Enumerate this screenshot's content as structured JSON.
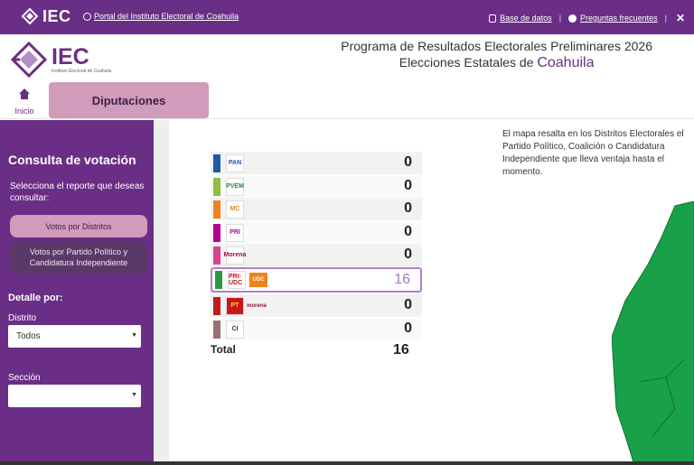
{
  "topbar": {
    "logo_text": "IEC",
    "portal_link": "Portal del Instituto Electoral de Coahuila",
    "links": [
      "Base de datos",
      "Preguntas frecuentes"
    ],
    "icons": [
      "database-icon",
      "question-icon",
      "close-icon"
    ]
  },
  "header": {
    "logo_text": "IEC",
    "logo_subtext": "Instituto Electoral de Coahuila",
    "title_line1": "Programa de Resultados Electorales Preliminares 2026",
    "title_line2": "Elecciones Estatales de",
    "title_state": "Coahuila"
  },
  "nav": {
    "home_label": "Inicio",
    "active_tab": "Diputaciones"
  },
  "sidebar": {
    "heading": "Consulta de votación",
    "hint": "Selecciona el reporte que deseas consultar:",
    "btn_districts": "Votos por Distritos",
    "btn_party": "Votos por Partido Político y Candidatura Independiente",
    "detail_label": "Detalle por:",
    "district_label": "Distrito",
    "district_value": "Todos",
    "section_label": "Sección",
    "section_value": ""
  },
  "main": {
    "description": "El mapa resalta en los Distritos Electorales el Partido Político, Coalición o Candidatura Independiente que lleva ventaja hasta el momento.",
    "rows": [
      {
        "party": "PAN",
        "color": "#1f5aa6",
        "votes": "0"
      },
      {
        "party": "PVEM",
        "color": "#8fbf3f",
        "votes": "0"
      },
      {
        "party": "MC",
        "color": "#f0821e",
        "votes": "0"
      },
      {
        "party": "PRI",
        "color": "#b5008f",
        "votes": "0"
      },
      {
        "party": "Morena",
        "color": "#d7458d",
        "votes": "0"
      },
      {
        "party": "PRI-UDC",
        "color": "#2a9b3c",
        "votes": "16",
        "label2": "UDC"
      },
      {
        "party": "PT",
        "color": "#c41a1a",
        "votes": "0",
        "label2": "morena"
      },
      {
        "party": "CI",
        "color": "#9a6e74",
        "votes": "0"
      }
    ],
    "total_label": "Total",
    "total_value": "16"
  },
  "colors": {
    "brand": "#6a2e86",
    "accent_pink": "#d19bbb",
    "map_green": "#19a14a"
  }
}
